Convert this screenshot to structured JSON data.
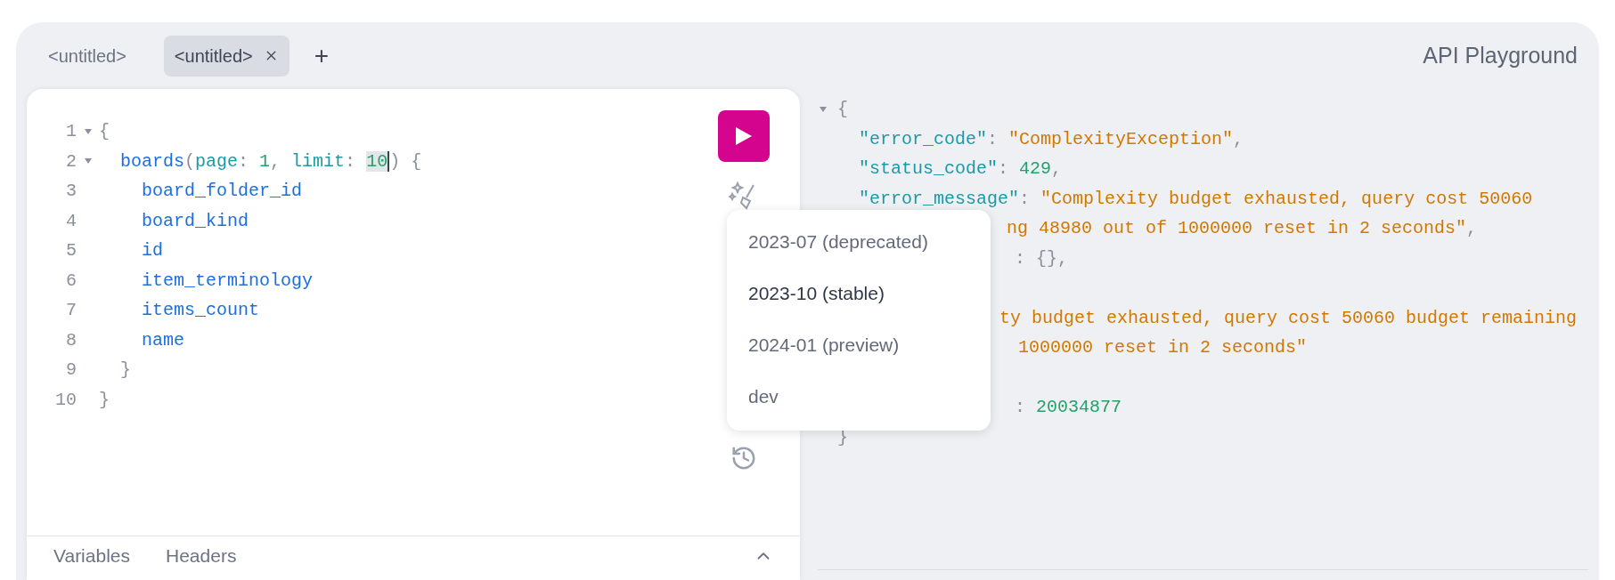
{
  "tabs": [
    {
      "label": "<untitled>",
      "selected": false
    },
    {
      "label": "<untitled>",
      "selected": true
    }
  ],
  "new_tab_button": "+",
  "title": "API Playground",
  "editor": {
    "lines": [
      {
        "number": "1",
        "foldable": true,
        "segments": [
          {
            "text": "{",
            "kind": "punct"
          }
        ]
      },
      {
        "number": "2",
        "foldable": true,
        "segments": [
          {
            "text": "  boards",
            "kind": "field"
          },
          {
            "text": "(",
            "kind": "punct"
          },
          {
            "text": "page",
            "kind": "arg"
          },
          {
            "text": ": ",
            "kind": "punct"
          },
          {
            "text": "1",
            "kind": "number"
          },
          {
            "text": ", ",
            "kind": "punct"
          },
          {
            "text": "limit",
            "kind": "arg"
          },
          {
            "text": ": ",
            "kind": "punct"
          },
          {
            "text": "10",
            "kind": "cursor-number"
          },
          {
            "text": ") {",
            "kind": "punct"
          }
        ]
      },
      {
        "number": "3",
        "foldable": false,
        "segments": [
          {
            "text": "    board_folder_id",
            "kind": "field"
          }
        ]
      },
      {
        "number": "4",
        "foldable": false,
        "segments": [
          {
            "text": "    board_kind",
            "kind": "field"
          }
        ]
      },
      {
        "number": "5",
        "foldable": false,
        "segments": [
          {
            "text": "    id",
            "kind": "field"
          }
        ]
      },
      {
        "number": "6",
        "foldable": false,
        "segments": [
          {
            "text": "    item_terminology",
            "kind": "field"
          }
        ]
      },
      {
        "number": "7",
        "foldable": false,
        "segments": [
          {
            "text": "    items_count",
            "kind": "field"
          }
        ]
      },
      {
        "number": "8",
        "foldable": false,
        "segments": [
          {
            "text": "    name",
            "kind": "field"
          }
        ]
      },
      {
        "number": "9",
        "foldable": false,
        "segments": [
          {
            "text": "  }",
            "kind": "punct"
          }
        ]
      },
      {
        "number": "10",
        "foldable": false,
        "segments": [
          {
            "text": "}",
            "kind": "punct"
          }
        ]
      }
    ],
    "bottom_tabs": [
      "Variables",
      "Headers"
    ]
  },
  "version_menu": [
    {
      "label": "2023-07 (deprecated)",
      "selected": false
    },
    {
      "label": "2023-10 (stable)",
      "selected": true
    },
    {
      "label": "2024-01 (preview)",
      "selected": false
    },
    {
      "label": "dev",
      "selected": false
    }
  ],
  "result": {
    "lines": [
      {
        "kind": "full",
        "foldable": true,
        "segments": [
          {
            "text": "{",
            "kind": "punct"
          }
        ]
      },
      {
        "kind": "full",
        "foldable": false,
        "segments": [
          {
            "text": "  \"error_code\"",
            "kind": "key"
          },
          {
            "text": ": ",
            "kind": "punct"
          },
          {
            "text": "\"ComplexityException\"",
            "kind": "string"
          },
          {
            "text": ",",
            "kind": "punct"
          }
        ]
      },
      {
        "kind": "full",
        "foldable": false,
        "segments": [
          {
            "text": "  \"status_code\"",
            "kind": "key"
          },
          {
            "text": ": ",
            "kind": "punct"
          },
          {
            "text": "429",
            "kind": "number"
          },
          {
            "text": ",",
            "kind": "punct"
          }
        ]
      },
      {
        "kind": "full",
        "foldable": false,
        "segments": [
          {
            "text": "  \"error_message\"",
            "kind": "key"
          },
          {
            "text": ": ",
            "kind": "punct"
          },
          {
            "text": "\"Complexity budget exhausted, query cost 50060",
            "kind": "string"
          }
        ]
      },
      {
        "kind": "partial",
        "segments": [
          {
            "text": "ng 48980 out of 1000000 reset in 2 seconds\"",
            "kind": "string"
          },
          {
            "text": ",",
            "kind": "punct"
          }
        ]
      },
      {
        "kind": "partial",
        "segments": [
          {
            "text": ": {},",
            "kind": "punct"
          }
        ]
      },
      {
        "kind": "covered"
      },
      {
        "kind": "partial",
        "segments": [
          {
            "text": "ty budget exhausted, query cost 50060 budget remaining",
            "kind": "string"
          }
        ]
      },
      {
        "kind": "partial",
        "segments": [
          {
            "text": "1000000 reset in 2 seconds\"",
            "kind": "string"
          }
        ]
      },
      {
        "kind": "covered"
      },
      {
        "kind": "partial",
        "segments": [
          {
            "text": ": ",
            "kind": "punct"
          },
          {
            "text": "20034877",
            "kind": "number"
          }
        ]
      },
      {
        "kind": "full",
        "foldable": false,
        "segments": [
          {
            "text": "}",
            "kind": "punct"
          }
        ]
      }
    ]
  }
}
